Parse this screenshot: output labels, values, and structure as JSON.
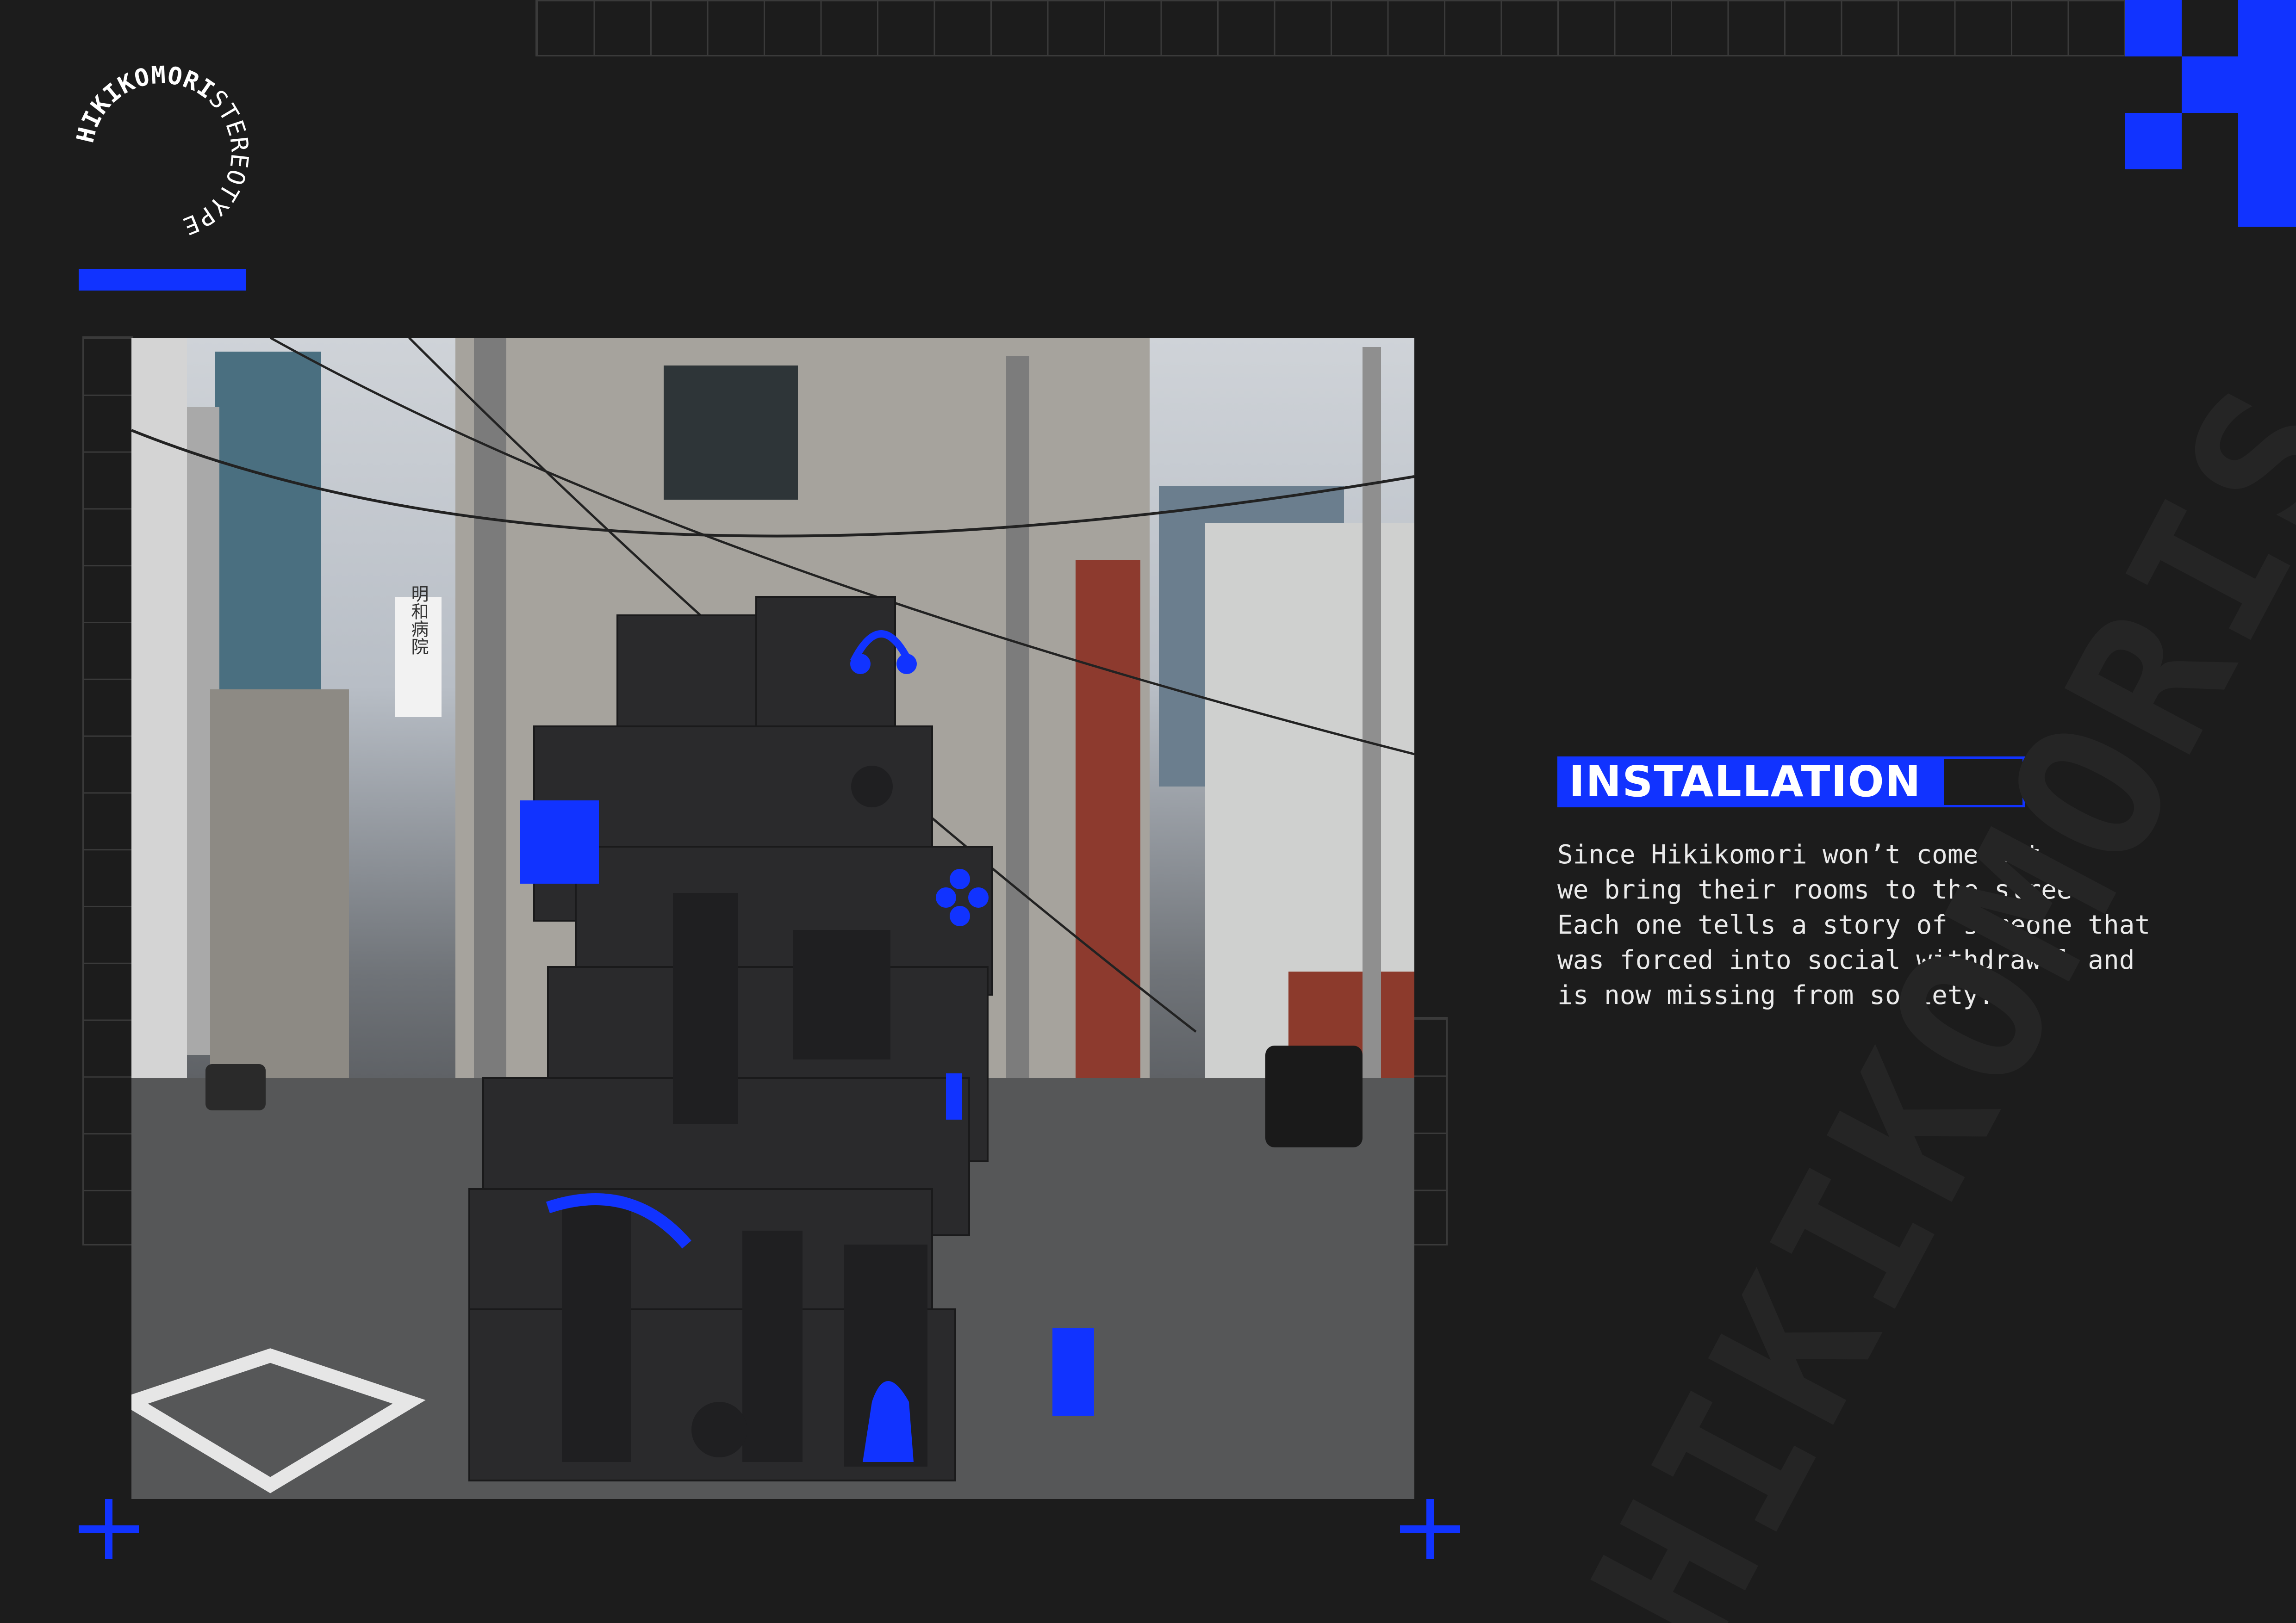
{
  "brand": {
    "logo_text": "HIKIKOMORISTEREOTYPE",
    "logo_bold": "HIKIKOMORI",
    "logo_light": "STEREOTYPE",
    "accent_color": "#1133ff"
  },
  "section": {
    "heading": "INSTALLATION",
    "body_lines": [
      "Since Hikikomori won’t come out,",
      "we bring their rooms to the streets.",
      "Each one tells a story of someone that",
      "was forced into social withdrawal and",
      "is now missing from society."
    ]
  },
  "photo": {
    "sign_text": "明和病院"
  },
  "watermark": {
    "text": "HIKIKOMORIS"
  }
}
